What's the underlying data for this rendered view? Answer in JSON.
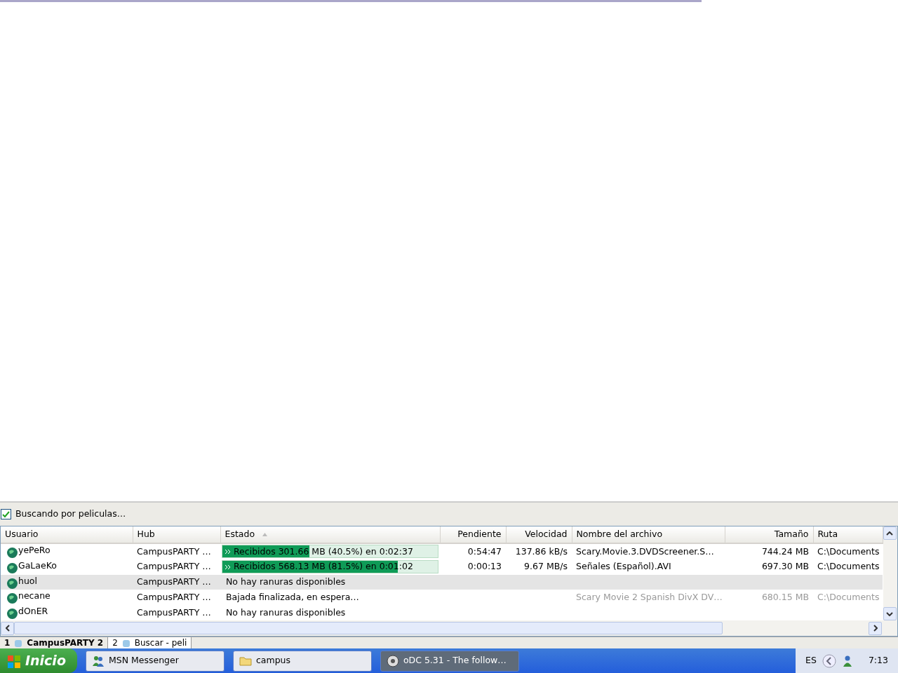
{
  "status": {
    "checked": true,
    "text": "Buscando por peliculas…"
  },
  "table": {
    "columns": [
      {
        "label": "Usuario",
        "sorted": false
      },
      {
        "label": "Hub",
        "sorted": false
      },
      {
        "label": "Estado",
        "sorted": true
      },
      {
        "label": "Pendiente",
        "sorted": false
      },
      {
        "label": "Velocidad",
        "sorted": false
      },
      {
        "label": "Nombre del archivo",
        "sorted": false
      },
      {
        "label": "Tamaño",
        "sorted": false
      },
      {
        "label": "Ruta",
        "sorted": false
      }
    ],
    "rows": [
      {
        "user": "yePeRo",
        "hub": "CampusPARTY …",
        "state": {
          "kind": "progress",
          "text": "Recibidos 301.66 MB (40.5%) en 0:02:37",
          "level": 0.405
        },
        "pending": "0:54:47",
        "speed": "137.86 kB/s",
        "file": "Scary.Movie.3.DVDScreener.S…",
        "size": "744.24 MB",
        "path": "C:\\Documents",
        "selected": false,
        "dimmed": false
      },
      {
        "user": "GaLaeKo",
        "hub": "CampusPARTY …",
        "state": {
          "kind": "progress",
          "text": "Recibidos 568.13 MB (81.5%) en 0:01:02",
          "level": 0.815
        },
        "pending": "0:00:13",
        "speed": "9.67 MB/s",
        "file": "Señales (Español).AVI",
        "size": "697.30 MB",
        "path": "C:\\Documents",
        "selected": false,
        "dimmed": false
      },
      {
        "user": "huol",
        "hub": "CampusPARTY …",
        "state": {
          "kind": "text",
          "text": "No hay ranuras disponibles"
        },
        "selected": true
      },
      {
        "user": "necane",
        "hub": "CampusPARTY …",
        "state": {
          "kind": "text",
          "text": "Bajada finalizada, en espera…"
        },
        "file": "Scary Movie 2 Spanish DivX DV…",
        "size": "680.15 MB",
        "path": "C:\\Documents",
        "selected": false,
        "dimmed": true
      },
      {
        "user": "dOnER",
        "hub": "CampusPARTY …",
        "state": {
          "kind": "text",
          "text": "No hay ranuras disponibles"
        },
        "selected": false
      }
    ]
  },
  "tabs": [
    {
      "number": "1",
      "label": "CampusPARTY 2",
      "selected": true
    },
    {
      "number": "2",
      "label": "Buscar - peli",
      "selected": false
    }
  ],
  "taskbar": {
    "start": "Inicio",
    "buttons": [
      {
        "label": "MSN Messenger",
        "kind": "messenger",
        "active": false
      },
      {
        "label": "campus",
        "kind": "folder",
        "active": false
      },
      {
        "label": "oDC 5.31 - The follow…",
        "kind": "app",
        "active": true
      }
    ],
    "language": "ES",
    "clock": "7:13"
  }
}
